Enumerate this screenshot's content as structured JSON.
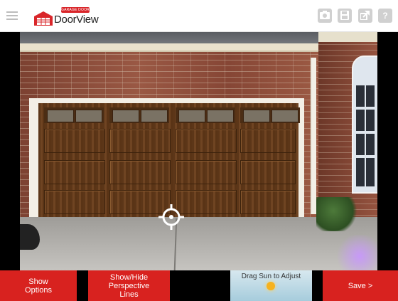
{
  "header": {
    "logo_badge": "GARAGE DOOR",
    "logo_text": "DoorView",
    "menu_icon": "hamburger-menu-icon",
    "tools": [
      "camera-icon",
      "save-icon",
      "share-icon",
      "help-icon"
    ],
    "help_glyph": "?"
  },
  "colors": {
    "action_red": "#d8221f",
    "header_icon_gray": "#d0d0d0"
  },
  "scene": {
    "description_icon": "position-target-icon"
  },
  "bottom_bar": {
    "show_options": "Show Options",
    "perspective": "Show/Hide Perspective Lines",
    "sun_label": "Drag Sun to Adjust",
    "save": "Save >"
  }
}
